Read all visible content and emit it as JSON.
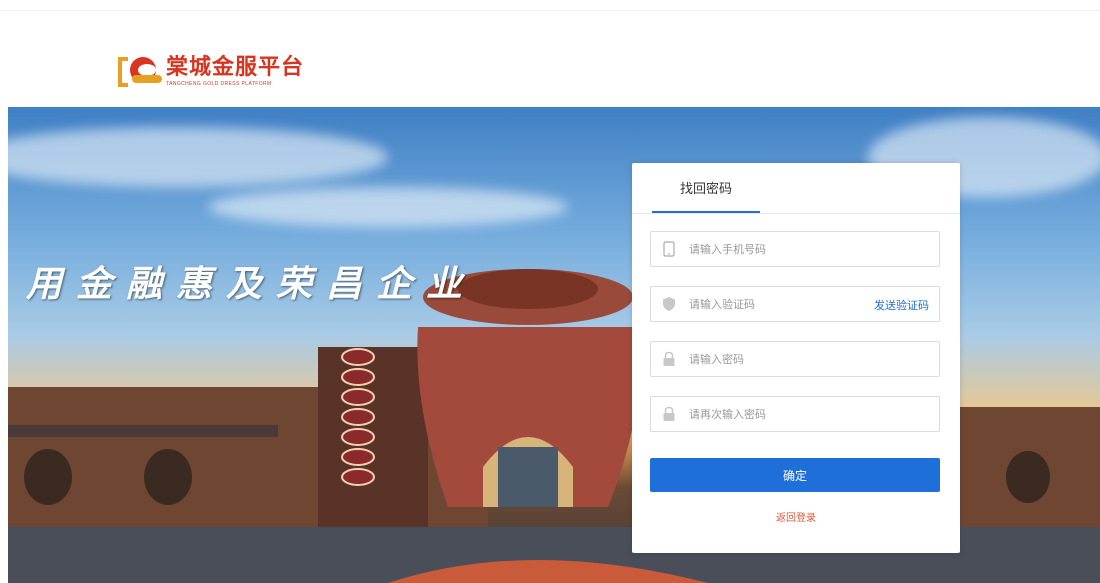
{
  "brand": {
    "name_cn": "棠城金服平台",
    "name_en": "TANGCHENG GOLD DRESS PLATFORM",
    "colors": {
      "primary": "#d9341f",
      "accent": "#e8a020"
    }
  },
  "banner": {
    "slogan": "用金融惠及荣昌企业"
  },
  "form": {
    "tab_label": "找回密码",
    "phone_placeholder": "请输入手机号码",
    "phone_icon": "phone-icon",
    "code_placeholder": "请输入验证码",
    "code_icon": "shield-icon",
    "send_code_label": "发送验证码",
    "password_placeholder": "请输入密码",
    "password_icon": "lock-icon",
    "confirm_placeholder": "请再次输入密码",
    "confirm_icon": "lock-icon",
    "submit_label": "确定",
    "back_label": "返回登录",
    "colors": {
      "button": "#1e6fd9",
      "link": "#1e6fd9",
      "back_link": "#e0573a"
    }
  }
}
